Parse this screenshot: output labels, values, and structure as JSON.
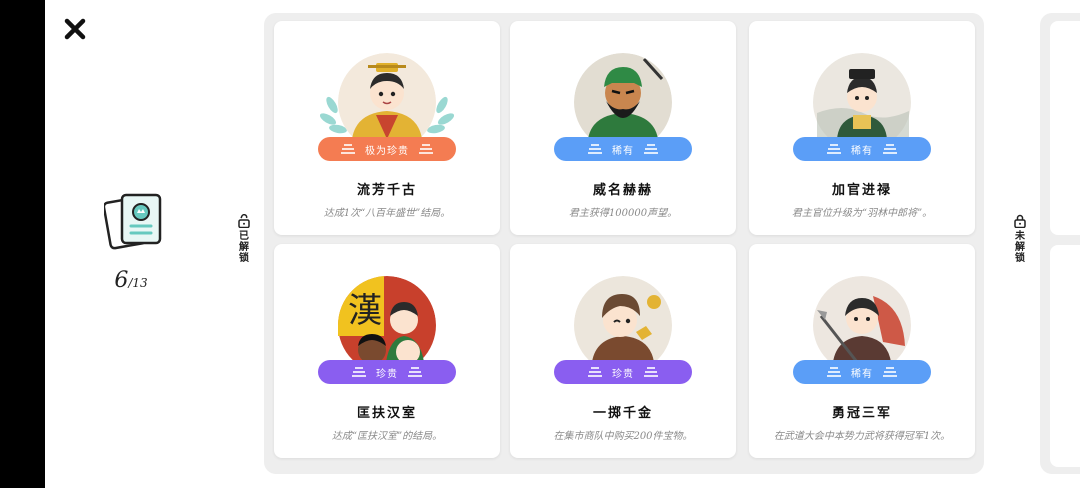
{
  "header": {
    "close_icon": "close-icon"
  },
  "progress": {
    "unlocked": "6",
    "total": "/13"
  },
  "sections": {
    "unlocked_label": "已解锁",
    "locked_label": "未解锁"
  },
  "colors": {
    "orange": "#f47c52",
    "blue": "#5b9ef7",
    "purple": "#8a5ef0",
    "panel": "#eeeeee",
    "teal": "#66c9bf"
  },
  "achievements": [
    {
      "title": "流芳千古",
      "desc": "达成1次“八百年盛世”结局。",
      "rarity": "极为珍贵",
      "color": "#f47c52",
      "icon": "emperor-avatar-icon"
    },
    {
      "title": "威名赫赫",
      "desc": "君主获得100000声望。",
      "rarity": "稀有",
      "color": "#5b9ef7",
      "icon": "general-avatar-icon"
    },
    {
      "title": "加官进禄",
      "desc": "君主官位升级为“羽林中郎将”。",
      "rarity": "稀有",
      "color": "#5b9ef7",
      "icon": "official-avatar-icon"
    },
    {
      "title": "匡扶汉室",
      "desc": "达成“匡扶汉室”的结局。",
      "rarity": "珍贵",
      "color": "#8a5ef0",
      "icon": "han-heroes-avatar-icon"
    },
    {
      "title": "一掷千金",
      "desc": "在集市商队中购买200件宝物。",
      "rarity": "珍贵",
      "color": "#8a5ef0",
      "icon": "merchant-avatar-icon"
    },
    {
      "title": "勇冠三军",
      "desc": "在武道大会中本势力武将获得冠军1次。",
      "rarity": "稀有",
      "color": "#5b9ef7",
      "icon": "warrior-avatar-icon"
    }
  ]
}
